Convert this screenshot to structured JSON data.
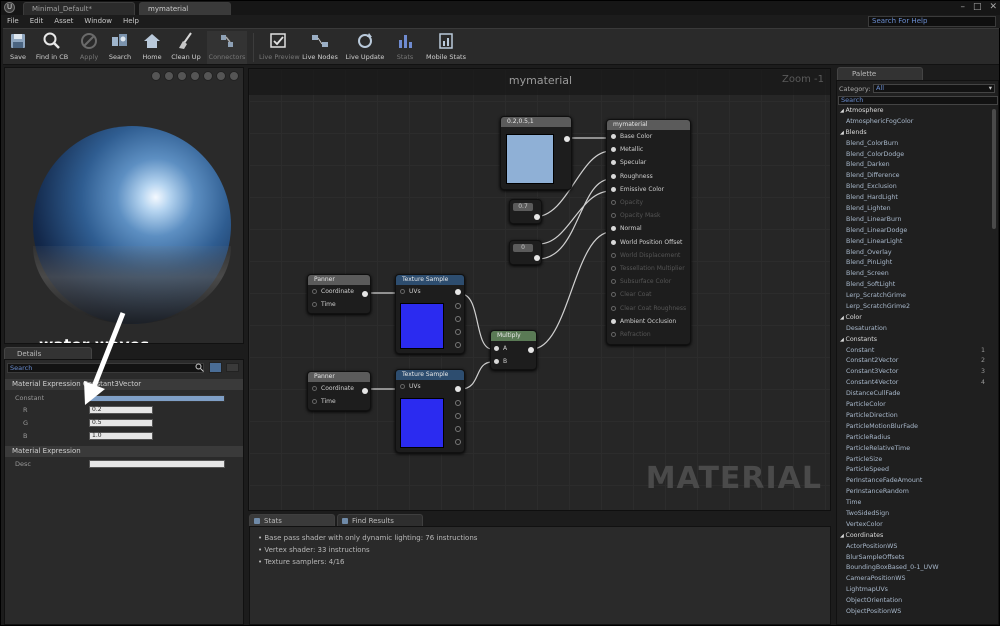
{
  "window": {
    "tabs": [
      "Minimal_Default*",
      "mymaterial"
    ],
    "help_search_placeholder": "Search For Help"
  },
  "menu": [
    "File",
    "Edit",
    "Asset",
    "Window",
    "Help"
  ],
  "toolbar": {
    "buttons": [
      {
        "label": "Save",
        "icon": "save-icon"
      },
      {
        "label": "Find in CB",
        "icon": "find-in-content-browser-icon"
      },
      {
        "label": "Apply",
        "icon": "apply-icon",
        "disabled": true
      },
      {
        "label": "Search",
        "icon": "search-icon"
      },
      {
        "label": "Home",
        "icon": "home-icon"
      },
      {
        "label": "Clean Up",
        "icon": "clean-up-icon"
      },
      {
        "label": "Connectors",
        "icon": "connectors-icon",
        "disabled": true
      },
      {
        "label": "Live Preview",
        "icon": "live-preview-icon",
        "disabled": true
      },
      {
        "label": "Live Nodes",
        "icon": "live-nodes-icon"
      },
      {
        "label": "Live Update",
        "icon": "live-update-icon"
      },
      {
        "label": "Stats",
        "icon": "stats-icon",
        "disabled": true
      },
      {
        "label": "Mobile Stats",
        "icon": "mobile-stats-icon"
      }
    ]
  },
  "viewport": {
    "annotation": "water waves\nspeed and directions"
  },
  "details": {
    "tab": "Details",
    "search_placeholder": "Search",
    "section1": "Material Expression Constant3Vector",
    "constant_label": "Constant",
    "r_label": "R",
    "r_value": "0.2",
    "g_label": "G",
    "g_value": "0.5",
    "b_label": "B",
    "b_value": "1.0",
    "section2": "Material Expression",
    "desc_label": "Desc"
  },
  "graph": {
    "title": "mymaterial",
    "zoom": "Zoom -1",
    "watermark": "MATERIAL",
    "const3_label": "0.2,0.5,1",
    "scalar1": "0.7",
    "scalar2": "0",
    "panner_title": "Panner",
    "panner_pins": [
      "Coordinate",
      "Time"
    ],
    "texture_title": "Texture Sample",
    "texture_pin": "UVs",
    "multiply_title": "Multiply",
    "multiply_pins": [
      "A",
      "B"
    ],
    "result_title": "mymaterial",
    "result_pins": [
      {
        "label": "Base Color",
        "active": true
      },
      {
        "label": "Metallic",
        "active": true
      },
      {
        "label": "Specular",
        "active": true
      },
      {
        "label": "Roughness",
        "active": true
      },
      {
        "label": "Emissive Color",
        "active": true
      },
      {
        "label": "Opacity",
        "active": false
      },
      {
        "label": "Opacity Mask",
        "active": false
      },
      {
        "label": "Normal",
        "active": true
      },
      {
        "label": "World Position Offset",
        "active": true
      },
      {
        "label": "World Displacement",
        "active": false
      },
      {
        "label": "Tessellation Multiplier",
        "active": false
      },
      {
        "label": "Subsurface Color",
        "active": false
      },
      {
        "label": "Clear Coat",
        "active": false
      },
      {
        "label": "Clear Coat Roughness",
        "active": false
      },
      {
        "label": "Ambient Occlusion",
        "active": true
      },
      {
        "label": "Refraction",
        "active": false
      }
    ]
  },
  "bottom_tabs": [
    "Stats",
    "Find Results"
  ],
  "stats": [
    "Base pass shader with only dynamic lighting: 76 instructions",
    "Vertex shader: 33 instructions",
    "Texture samplers: 4/16"
  ],
  "palette": {
    "tab": "Palette",
    "category_label": "Category:",
    "category_value": "All",
    "search_placeholder": "Search",
    "items": [
      {
        "t": "Atmosphere",
        "cat": true
      },
      {
        "t": "AtmosphericFogColor"
      },
      {
        "t": "Blends",
        "cat": true
      },
      {
        "t": "Blend_ColorBurn"
      },
      {
        "t": "Blend_ColorDodge"
      },
      {
        "t": "Blend_Darken"
      },
      {
        "t": "Blend_Difference"
      },
      {
        "t": "Blend_Exclusion"
      },
      {
        "t": "Blend_HardLight"
      },
      {
        "t": "Blend_Lighten"
      },
      {
        "t": "Blend_LinearBurn"
      },
      {
        "t": "Blend_LinearDodge"
      },
      {
        "t": "Blend_LinearLight"
      },
      {
        "t": "Blend_Overlay"
      },
      {
        "t": "Blend_PinLight"
      },
      {
        "t": "Blend_Screen"
      },
      {
        "t": "Blend_SoftLight"
      },
      {
        "t": "Lerp_ScratchGrime"
      },
      {
        "t": "Lerp_ScratchGrime2"
      },
      {
        "t": "Color",
        "cat": true
      },
      {
        "t": "Desaturation"
      },
      {
        "t": "Constants",
        "cat": true
      },
      {
        "t": "Constant",
        "sc": "1"
      },
      {
        "t": "Constant2Vector",
        "sc": "2"
      },
      {
        "t": "Constant3Vector",
        "sc": "3"
      },
      {
        "t": "Constant4Vector",
        "sc": "4"
      },
      {
        "t": "DistanceCullFade"
      },
      {
        "t": "ParticleColor"
      },
      {
        "t": "ParticleDirection"
      },
      {
        "t": "ParticleMotionBlurFade"
      },
      {
        "t": "ParticleRadius"
      },
      {
        "t": "ParticleRelativeTime"
      },
      {
        "t": "ParticleSize"
      },
      {
        "t": "ParticleSpeed"
      },
      {
        "t": "PerInstanceFadeAmount"
      },
      {
        "t": "PerInstanceRandom"
      },
      {
        "t": "Time"
      },
      {
        "t": "TwoSidedSign"
      },
      {
        "t": "VertexColor"
      },
      {
        "t": "Coordinates",
        "cat": true
      },
      {
        "t": "ActorPositionWS"
      },
      {
        "t": "BlurSampleOffsets"
      },
      {
        "t": "BoundingBoxBased_0-1_UVW"
      },
      {
        "t": "CameraPositionWS"
      },
      {
        "t": "LightmapUVs"
      },
      {
        "t": "ObjectOrientation"
      },
      {
        "t": "ObjectPositionWS"
      }
    ]
  },
  "colors": {
    "const3_preview": "#8fb0d6",
    "texture_preview": "#2b2bf0",
    "node_header_blue": "#2d4d6f",
    "node_header_gray": "#5b5b5b",
    "node_header_green": "#5a7a55"
  }
}
